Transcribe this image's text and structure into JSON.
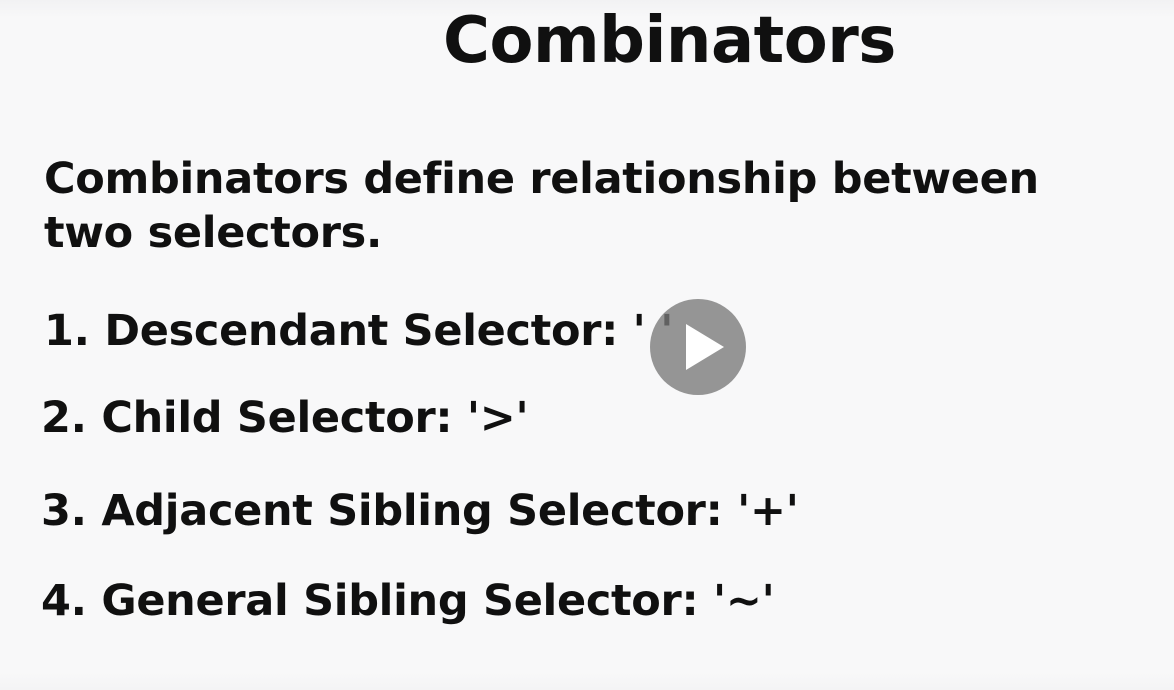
{
  "slide": {
    "title": "Combinators",
    "intro": "Combinators define relationship between two selectors.",
    "items": [
      "1. Descendant Selector: ' '",
      "2. Child Selector: '>'",
      "3. Adjacent Sibling Selector: '+'",
      "4. General Sibling Selector: '~'"
    ]
  },
  "player": {
    "play_icon": "play-icon",
    "overlay_color": "#787878"
  }
}
